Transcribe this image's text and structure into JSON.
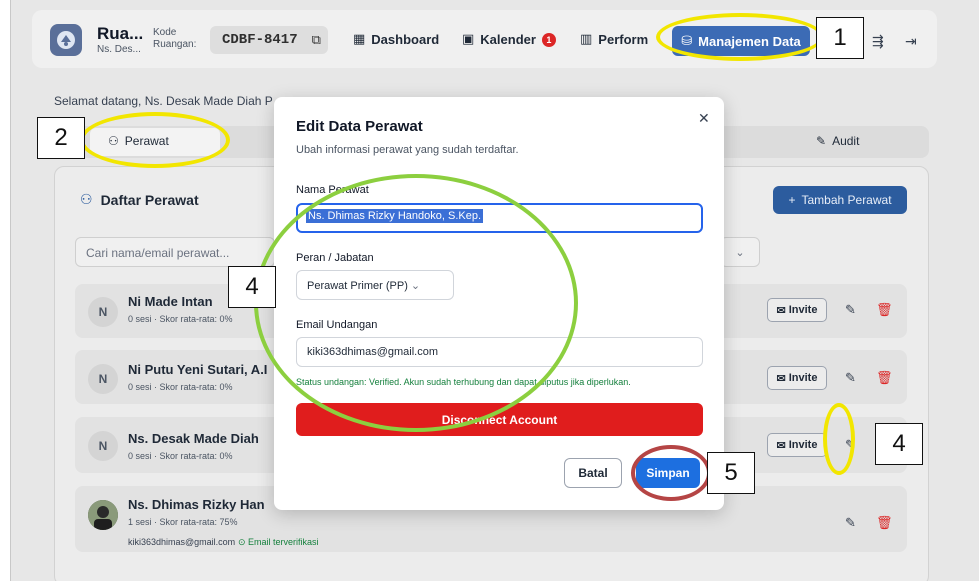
{
  "header": {
    "brand_name": "Rua...",
    "brand_sub": "Ns. Des...",
    "kode_label_1": "Kode",
    "kode_label_2": "Ruangan:",
    "room_code": "CDBF-8417",
    "nav": {
      "dashboard": "Dashboard",
      "kalender": "Kalender",
      "kalender_badge": "1",
      "performa": "Perform",
      "manajemen": "Manajemen Data"
    }
  },
  "welcome_text": "Selamat datang, Ns. Desak Made Diah P",
  "tabs": {
    "perawat": "Perawat",
    "audit": "Audit"
  },
  "panel": {
    "title": "Daftar Perawat",
    "add_button": "Tambah Perawat",
    "search_placeholder": "Cari nama/email perawat...",
    "rows": [
      {
        "initial": "N",
        "name": "Ni Made Intan",
        "meta": "0 sesi · Skor rata-rata: 0%",
        "invite": "Invite"
      },
      {
        "initial": "N",
        "name": "Ni Putu Yeni Sutari, A.I",
        "meta": "0 sesi · Skor rata-rata: 0%",
        "invite": "Invite"
      },
      {
        "initial": "N",
        "name": "Ns. Desak Made Diah",
        "meta": "0 sesi · Skor rata-rata: 0%",
        "invite": "Invite"
      },
      {
        "initial": "",
        "name": "Ns. Dhimas Rizky Han",
        "meta": "1 sesi · Skor rata-rata: 75%",
        "email": "kiki363dhimas@gmail.com",
        "verified": "Email terverifikasi"
      }
    ]
  },
  "modal": {
    "title": "Edit Data Perawat",
    "subtitle": "Ubah informasi perawat yang sudah terdaftar.",
    "name_label": "Nama Perawat",
    "name_value": "Ns. Dhimas Rizky Handoko, S.Kep.",
    "role_label": "Peran / Jabatan",
    "role_value": "Perawat Primer (PP)",
    "email_label": "Email Undangan",
    "email_value": "kiki363dhimas@gmail.com",
    "status_text": "Status undangan: Verified. Akun sudah terhubung dan dapat diputus jika diperlukan.",
    "disconnect_label": "Disconnect Account",
    "cancel_label": "Batal",
    "save_label": "Simpan"
  },
  "annotations": [
    "1",
    "2",
    "4",
    "4",
    "5"
  ],
  "colors": {
    "accent_blue": "#3c6bb5",
    "danger_red": "#e01d1d",
    "save_blue": "#1d6fe0",
    "annotation_yellow": "#f2e600",
    "annotation_green": "#8ccf3f",
    "annotation_red": "#b54545"
  }
}
